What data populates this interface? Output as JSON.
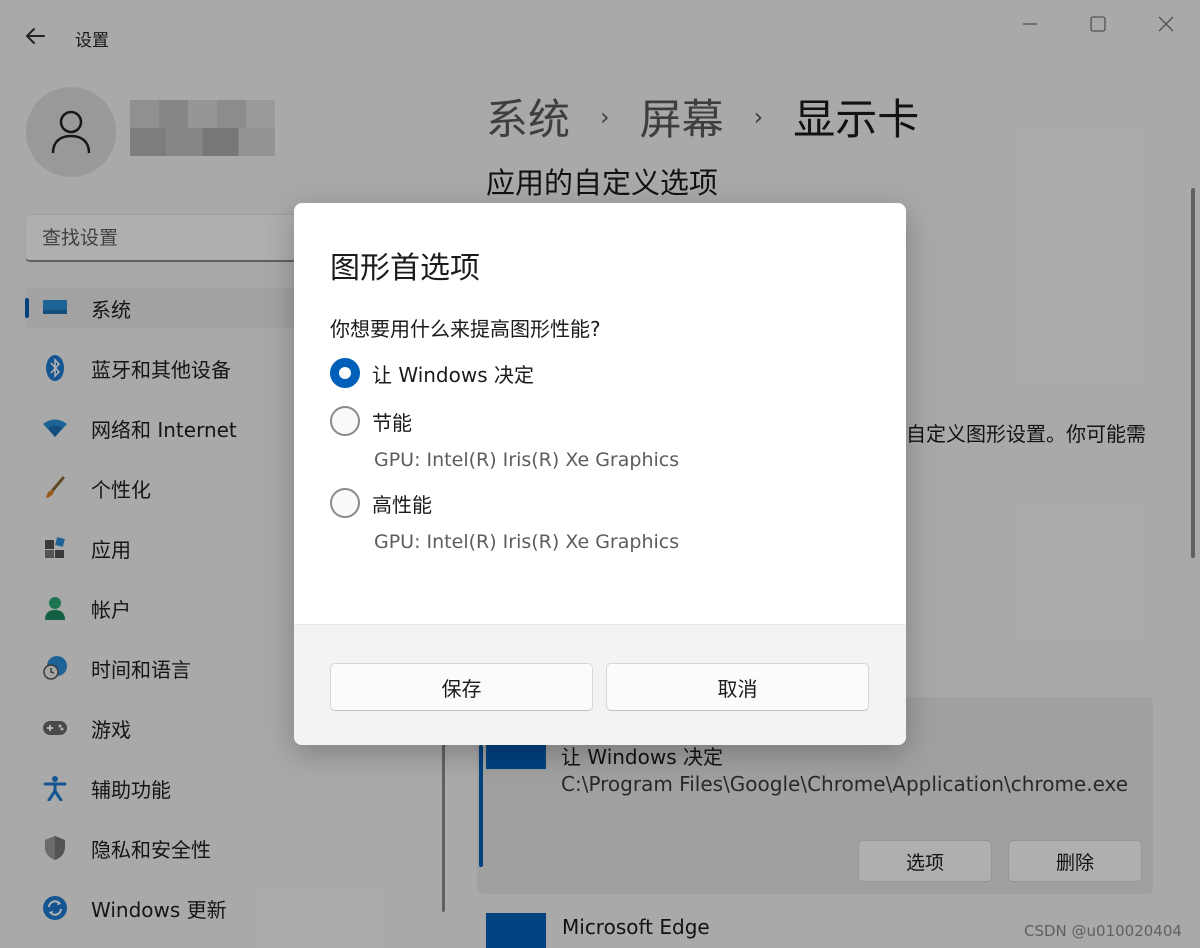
{
  "window": {
    "app_title": "设置"
  },
  "search": {
    "placeholder": "查找设置"
  },
  "sidebar": {
    "items": [
      {
        "label": "系统",
        "icon": "monitor-icon"
      },
      {
        "label": "蓝牙和其他设备",
        "icon": "bluetooth-icon"
      },
      {
        "label": "网络和 Internet",
        "icon": "wifi-icon"
      },
      {
        "label": "个性化",
        "icon": "brush-icon"
      },
      {
        "label": "应用",
        "icon": "apps-icon"
      },
      {
        "label": "帐户",
        "icon": "person-icon"
      },
      {
        "label": "时间和语言",
        "icon": "clock-globe-icon"
      },
      {
        "label": "游戏",
        "icon": "gamepad-icon"
      },
      {
        "label": "辅助功能",
        "icon": "accessibility-icon"
      },
      {
        "label": "隐私和安全性",
        "icon": "shield-icon"
      },
      {
        "label": "Windows 更新",
        "icon": "update-icon"
      }
    ]
  },
  "main": {
    "breadcrumb": [
      "系统",
      "屏幕",
      "显示卡"
    ],
    "section_title": "应用的自定义选项",
    "description_fragment": "自定义图形设置。你可能需",
    "app_card": {
      "preference": "让 Windows 决定",
      "path": "C:\\Program Files\\Google\\Chrome\\Application\\chrome.exe",
      "options_label": "选项",
      "delete_label": "删除"
    },
    "next_app": "Microsoft Edge"
  },
  "dialog": {
    "title": "图形首选项",
    "question": "你想要用什么来提高图形性能?",
    "options": [
      {
        "label": "让 Windows 决定",
        "selected": true,
        "gpu": ""
      },
      {
        "label": "节能",
        "selected": false,
        "gpu": "GPU: Intel(R) Iris(R) Xe Graphics"
      },
      {
        "label": "高性能",
        "selected": false,
        "gpu": "GPU: Intel(R) Iris(R) Xe Graphics"
      }
    ],
    "save_label": "保存",
    "cancel_label": "取消"
  },
  "watermark": "CSDN @u010020404",
  "colors": {
    "accent": "#005fb8",
    "background": "#f3f3f3"
  }
}
